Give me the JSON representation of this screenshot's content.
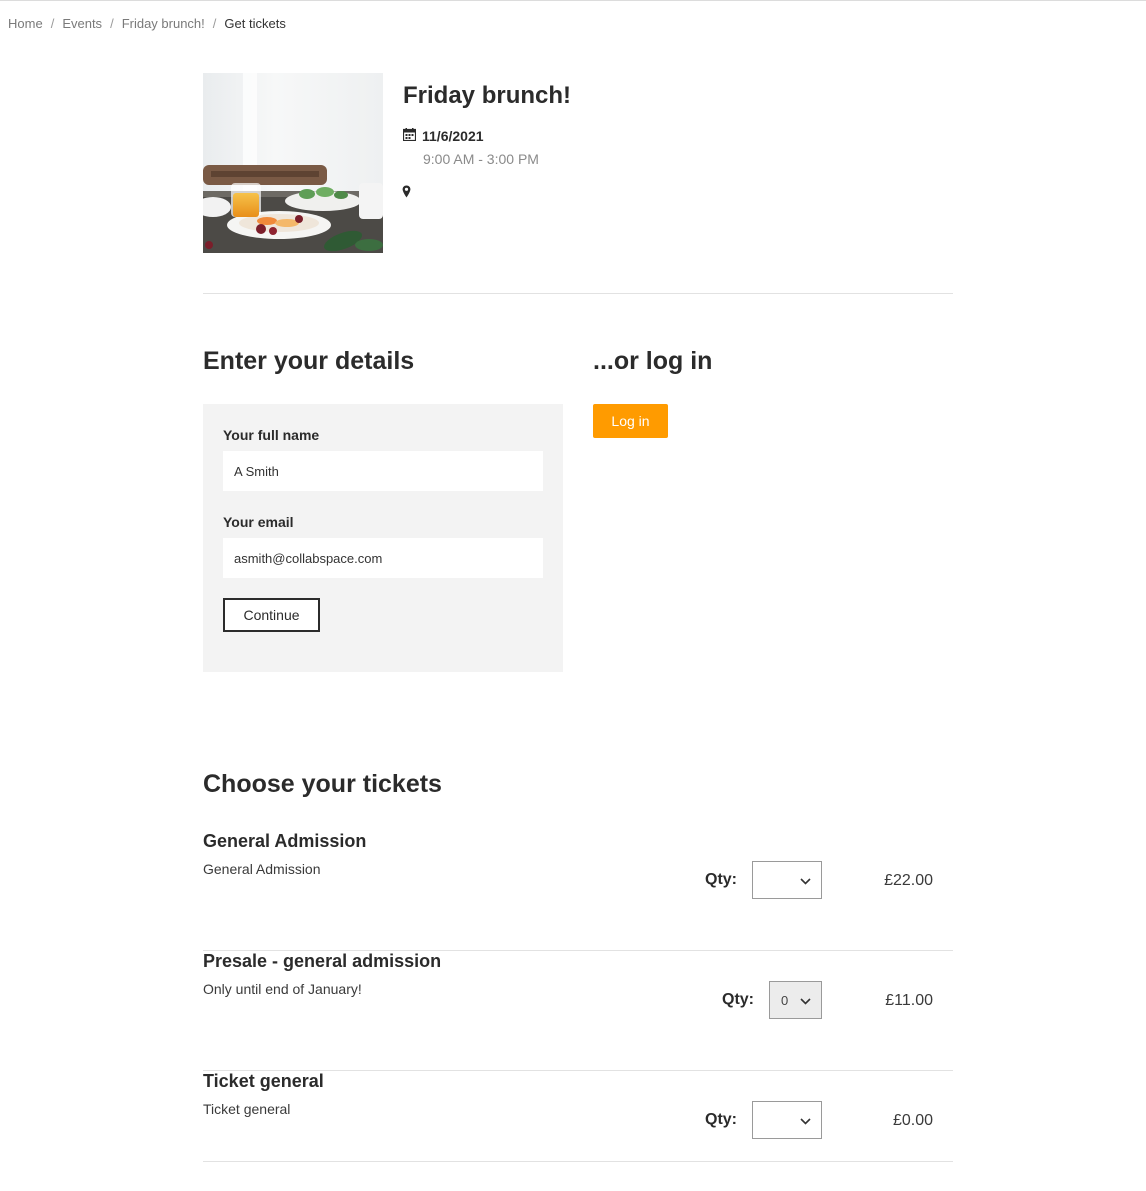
{
  "breadcrumb": {
    "items": [
      "Home",
      "Events",
      "Friday brunch!"
    ],
    "separator": "/",
    "current": "Get tickets"
  },
  "event": {
    "title": "Friday brunch!",
    "date": "11/6/2021",
    "time": "9:00 AM - 3:00 PM",
    "location": ""
  },
  "details": {
    "heading": "Enter your details",
    "name_label": "Your full name",
    "name_value": "A Smith",
    "email_label": "Your email",
    "email_value": "asmith@collabspace.com",
    "continue_label": "Continue"
  },
  "login": {
    "heading": "...or log in",
    "button_label": "Log in",
    "accent": "#ff9b00"
  },
  "tickets": {
    "heading": "Choose your tickets",
    "qty_label": "Qty:",
    "items": [
      {
        "name": "General Admission",
        "description": "General Admission",
        "qty": "",
        "price": "£22.00"
      },
      {
        "name": "Presale - general admission",
        "description": "Only until end of January!",
        "qty": "0",
        "price": "£11.00"
      },
      {
        "name": "Ticket general",
        "description": "Ticket general",
        "qty": "",
        "price": "£0.00"
      }
    ]
  }
}
